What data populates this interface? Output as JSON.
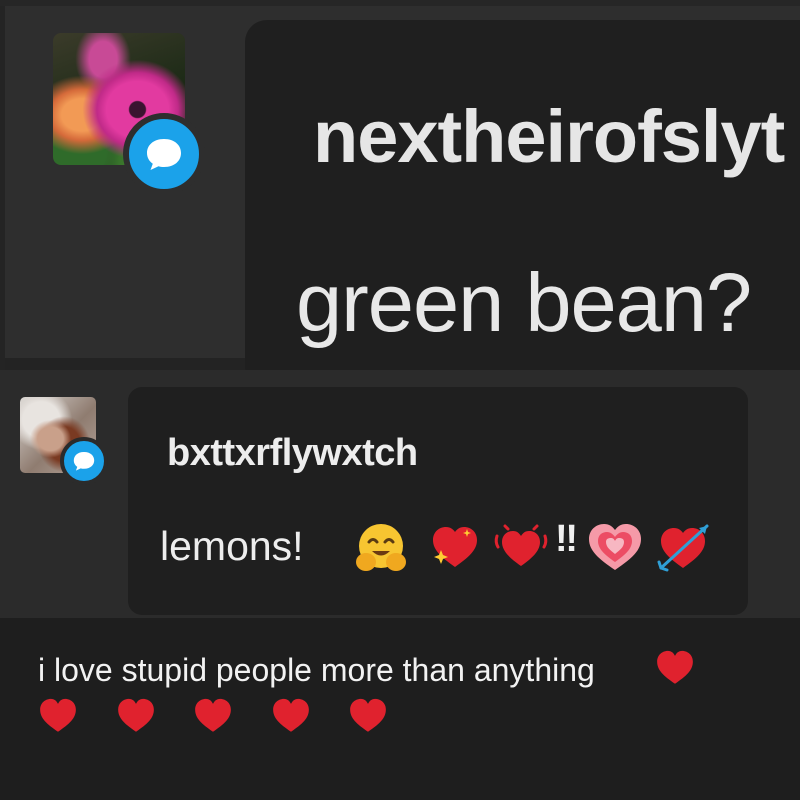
{
  "comment_1": {
    "username": "nextheirofslyt",
    "message": "green bean?",
    "avatar_icon": "flower-avatar",
    "badge_icon": "speech-bubble-icon"
  },
  "comment_2": {
    "username": "bxttxrflywxtch",
    "message": "lemons!",
    "avatar_icon": "person-avatar",
    "badge_icon": "speech-bubble-icon",
    "emojis": [
      "hugging-face-emoji",
      "sparkling-heart-emoji",
      "beating-heart-emoji",
      "double-exclamation",
      "growing-heart-emoji",
      "heart-with-arrow-emoji"
    ],
    "double_exclamation": "‼"
  },
  "caption": {
    "text": "i love stupid people more than anything",
    "hearts_count": 6
  },
  "colors": {
    "badge_blue": "#1ba2ea",
    "heart_red": "#e0222e",
    "bubble_bg": "#1f1f1f"
  }
}
